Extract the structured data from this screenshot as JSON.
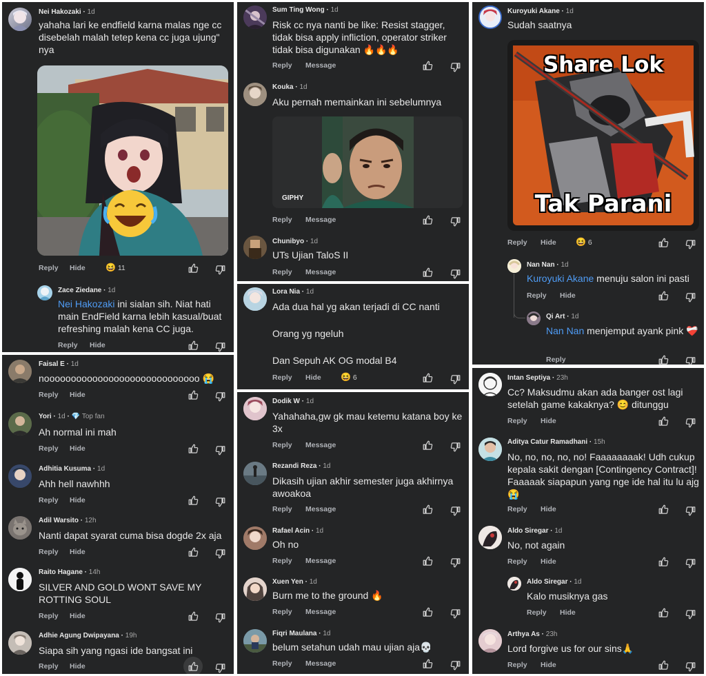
{
  "labels": {
    "reply": "Reply",
    "hide": "Hide",
    "message": "Message",
    "giphy": "GIPHY"
  },
  "col1": {
    "c1": {
      "name": "Nei Hakozaki",
      "time": "1d",
      "text": "yahaha lari ke endfield karna malas nge cc disebelah malah tetep kena cc juga ujung\" nya",
      "reaction_count": "11"
    },
    "c1r": {
      "name": "Zace Ziedane",
      "time": "1d",
      "mention": "Nei Hakozaki",
      "text": " ini sialan sih. Niat hati main EndField karna lebih kasual/buat refreshing malah kena CC juga."
    },
    "c2": {
      "name": "Faisal E",
      "time": "1d",
      "text": "nooooooooooooooooooooooooooooo 😭"
    },
    "c3": {
      "name": "Yori",
      "time": "1d",
      "badge": "Top fan",
      "text": "Ah normal ini mah"
    },
    "c4": {
      "name": "Adhitia Kusuma",
      "time": "1d",
      "text": "Ahh hell nawhhh"
    },
    "c5": {
      "name": "Adil Warsito",
      "time": "12h",
      "text": "Nanti dapat syarat cuma bisa dogde 2x aja"
    },
    "c6": {
      "name": "Raito Hagane",
      "time": "14h",
      "text": "SILVER AND GOLD WONT SAVE MY ROTTING SOUL"
    },
    "c7": {
      "name": "Adhie Agung Dwipayana",
      "time": "19h",
      "text": "Siapa sih yang ngasi ide bangsat ini"
    }
  },
  "col2": {
    "c1": {
      "name": "Sum Ting Wong",
      "time": "1d",
      "text": "Risk cc nya nanti be like: Resist stagger, tidak bisa apply infliction, operator striker tidak bisa digunakan 🔥🔥🔥"
    },
    "c2": {
      "name": "Kouka",
      "time": "1d",
      "text": "Aku pernah memainkan ini sebelumnya"
    },
    "c3": {
      "name": "Chunibyo",
      "time": "1d",
      "text": "UTs Ujian TaloS II"
    },
    "c4": {
      "name": "Lora Nia",
      "time": "1d",
      "line1": "Ada dua hal yg akan terjadi di CC nanti",
      "line2": "Orang yg ngeluh",
      "line3": "Dan Sepuh AK OG modal B4",
      "reaction_count": "6"
    },
    "c5": {
      "name": "Dodik W",
      "time": "1d",
      "text": "Yahahaha,gw gk mau ketemu katana boy ke 3x"
    },
    "c6": {
      "name": "Rezandi Reza",
      "time": "1d",
      "text": "Dikasih ujian akhir semester juga akhirnya awoakoa"
    },
    "c7": {
      "name": "Rafael Acin",
      "time": "1d",
      "text": "Oh no"
    },
    "c8": {
      "name": "Xuen Yen",
      "time": "1d",
      "text": "Burn me to the ground 🔥"
    },
    "c9": {
      "name": "Fiqri Maulana",
      "time": "1d",
      "text": "belum setahun udah mau ujian aja💀"
    }
  },
  "col3": {
    "c1": {
      "name": "Kuroyuki Akane",
      "time": "1d",
      "text": "Sudah saatnya",
      "meme_top": "Share Lok",
      "meme_bottom": "Tak Parani",
      "reaction_count": "6"
    },
    "c1r1": {
      "name": "Nan Nan",
      "time": "1d",
      "mention": "Kuroyuki Akane",
      "text": " menuju salon ini pasti"
    },
    "c1r2": {
      "name": "Qi Art",
      "time": "1d",
      "mention": "Nan Nan",
      "text": " menjemput ayank pink ❤️‍🩹"
    },
    "c2": {
      "name": "Intan Septiya",
      "time": "23h",
      "text": "Cc? Maksudmu akan ada banger ost lagi setelah game kakaknya? 😊 ditunggu"
    },
    "c3": {
      "name": "Aditya Catur Ramadhani",
      "time": "15h",
      "text": "No, no, no, no, no! Faaaaaaaak! Udh cukup kepala sakit dengan [Contingency Contract]! Faaaaak siapapun yang nge ide hal itu lu ajg 😭"
    },
    "c4": {
      "name": "Aldo Siregar",
      "time": "1d",
      "text": "No, not again"
    },
    "c4r": {
      "name": "Aldo Siregar",
      "time": "1d",
      "text": "Kalo musiknya gas"
    },
    "c5": {
      "name": "Arthya As",
      "time": "23h",
      "text": "Lord forgive us for our sins🙏"
    }
  },
  "colors": {
    "panel_bg": "#242526",
    "mention": "#4f9cf5",
    "action_gray": "#b0b3b8",
    "divider": "#ffffff"
  }
}
